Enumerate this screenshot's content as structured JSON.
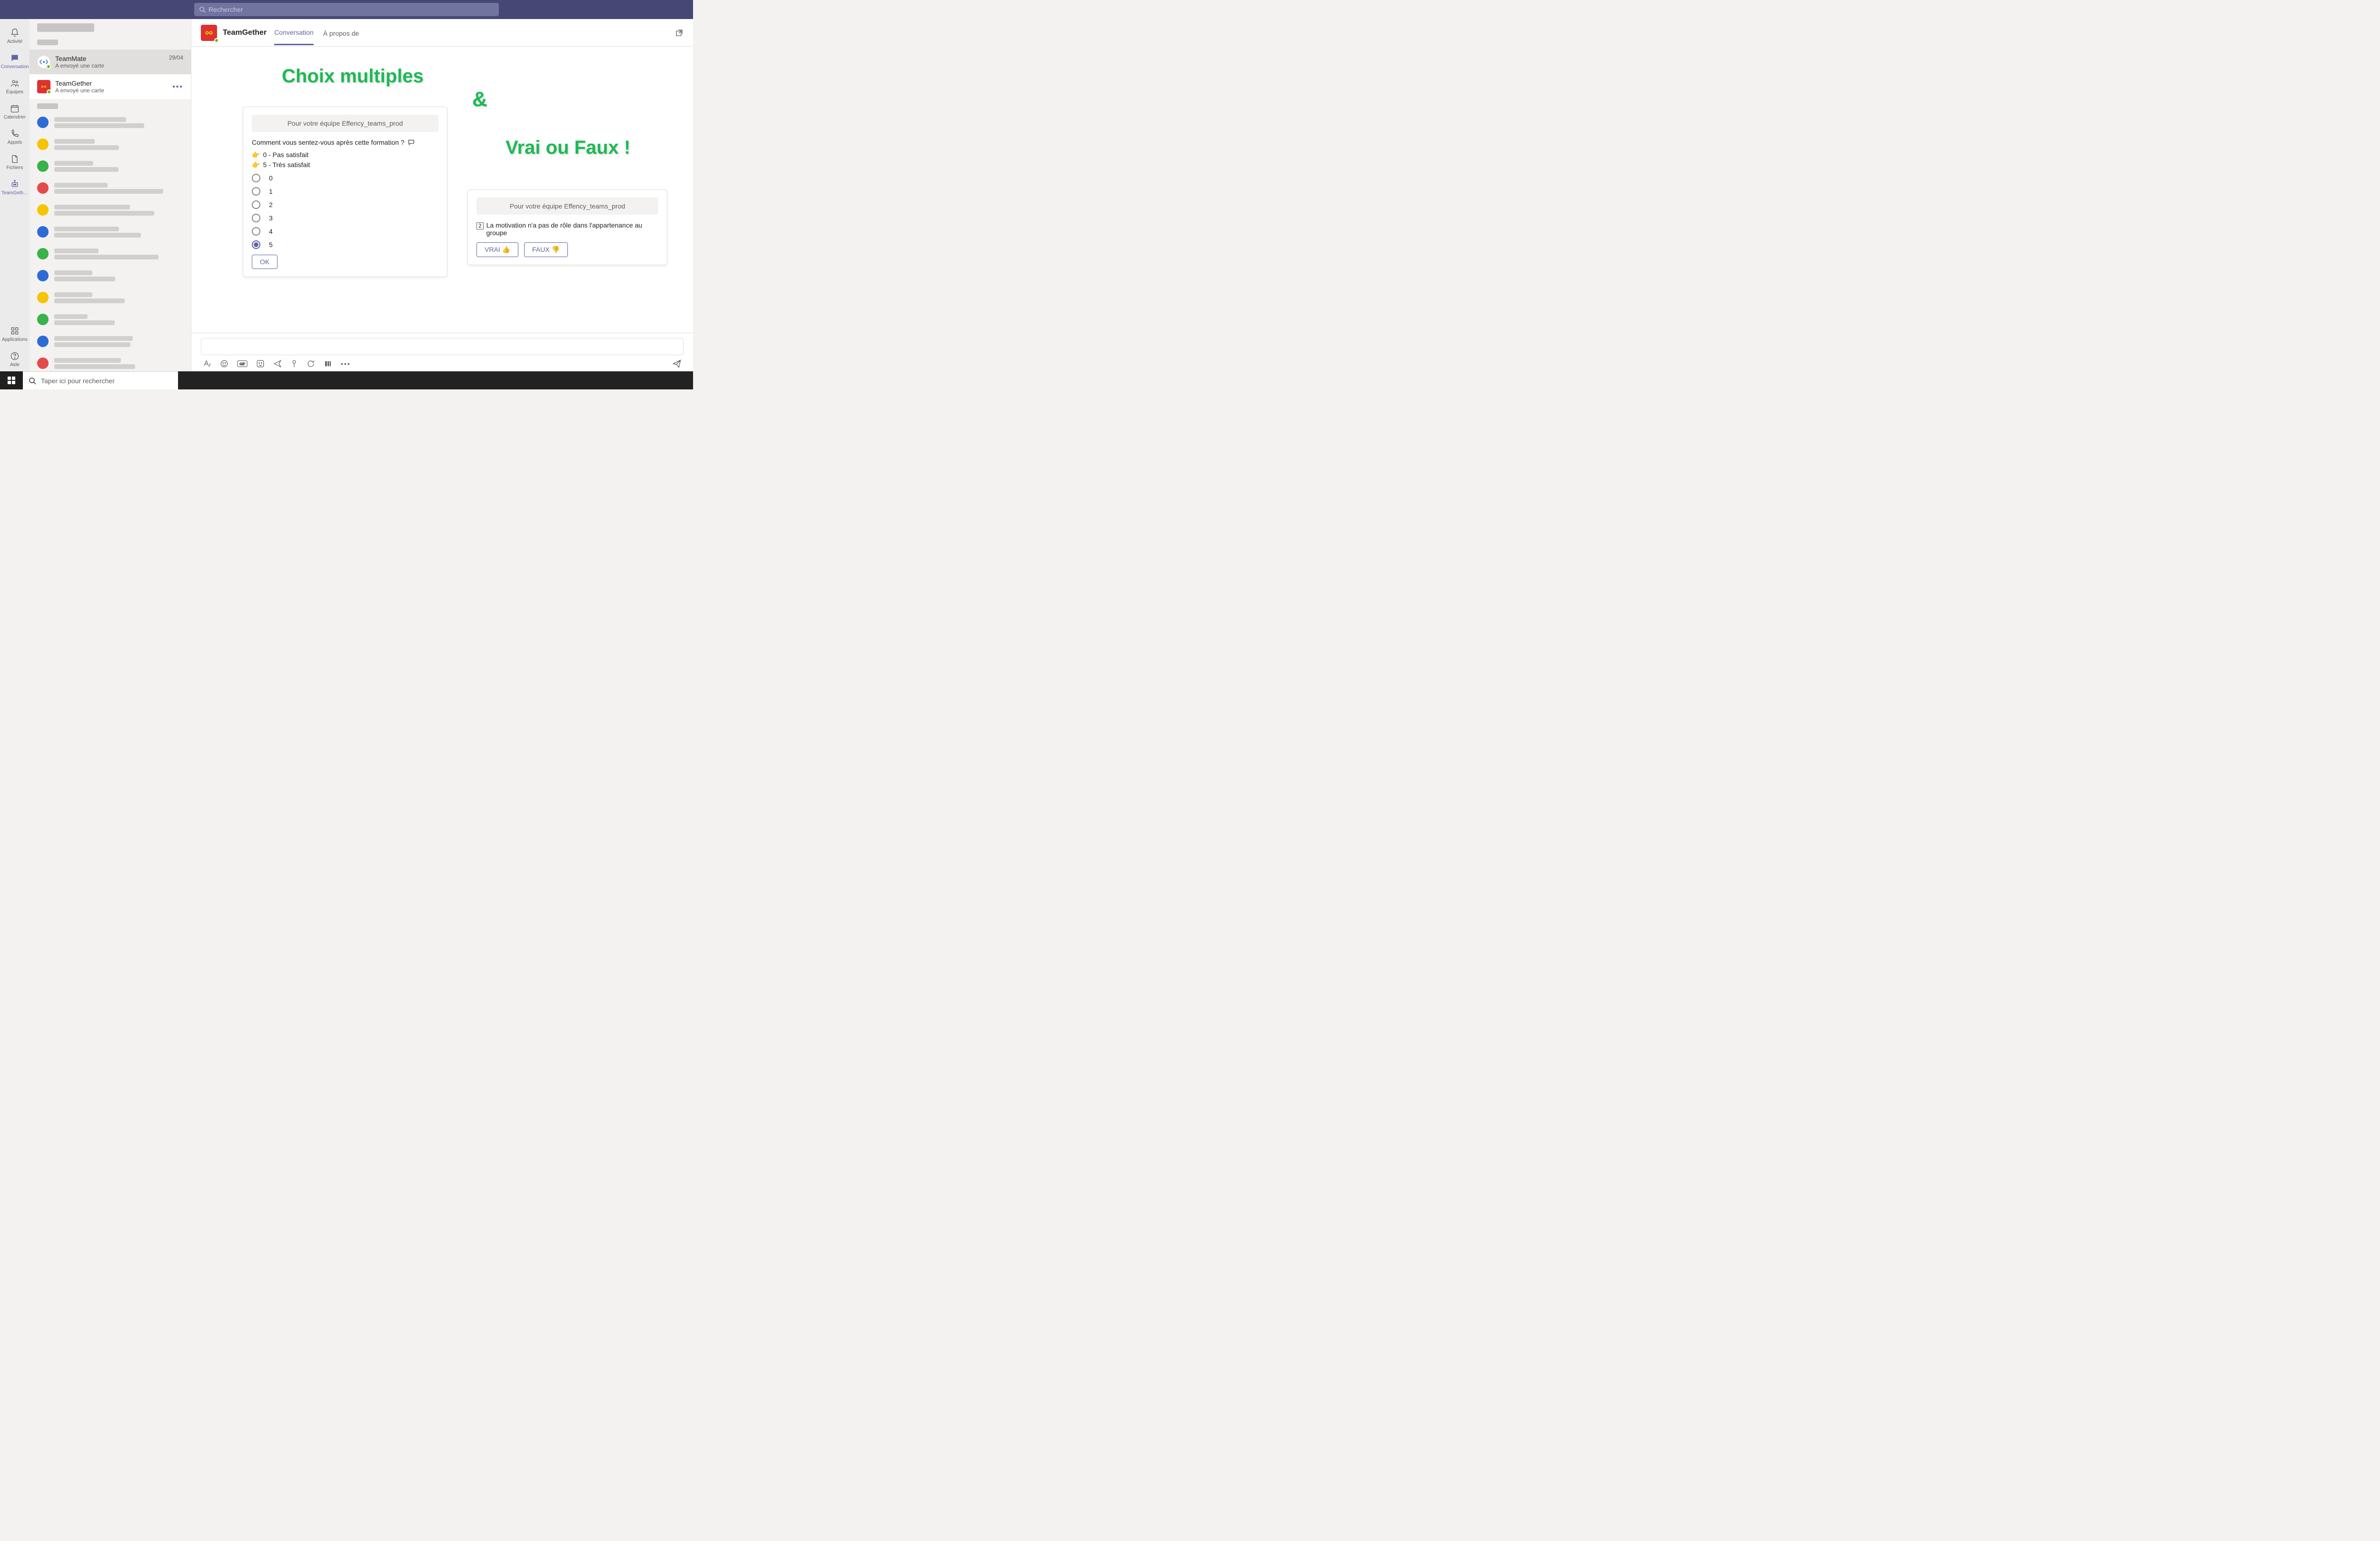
{
  "search_placeholder": "Rechercher",
  "rail": {
    "activity": "Activité",
    "conversation": "Conversation",
    "teams": "Équipes",
    "calendar": "Calendrier",
    "calls": "Appels",
    "files": "Fichiers",
    "teamgether": "TeamGeth…",
    "apps": "Applications",
    "help": "Aide"
  },
  "chatlist": {
    "items": [
      {
        "name": "TeamMate",
        "subtitle": "A envoyé une carte",
        "meta": "29/04"
      },
      {
        "name": "TeamGether",
        "subtitle": "A envoyé une carte",
        "meta": ""
      }
    ]
  },
  "conv_header": {
    "title": "TeamGether",
    "tab_conversation": "Conversation",
    "tab_about": "À propos de"
  },
  "headlines": {
    "multi": "Choix multiples",
    "amp": "&",
    "tf": "Vrai ou Faux !"
  },
  "card_multi": {
    "banner": "Pour votre équipe Effency_teams_prod",
    "question": "Comment vous sentez-vous après cette formation ?",
    "legend_low": "0 - Pas satisfait",
    "legend_high": "5 - Très satisfait",
    "options": [
      "0",
      "1",
      "2",
      "3",
      "4",
      "5"
    ],
    "selected": "5",
    "ok": "OK"
  },
  "card_tf": {
    "banner": "Pour votre équipe Effency_teams_prod",
    "question": "La motivation n'a pas de rôle dans l'appartenance au groupe",
    "true": "VRAI",
    "false": "FAUX"
  },
  "taskbar_search": "Taper ici pour rechercher",
  "placeholder_dots": [
    "#2e6bd6",
    "#f6c400",
    "#38b24a",
    "#e34b4b",
    "#f6c400",
    "#2e6bd6",
    "#38b24a",
    "#2e6bd6",
    "#f6c400",
    "#38b24a",
    "#2e6bd6",
    "#e34b4b"
  ]
}
